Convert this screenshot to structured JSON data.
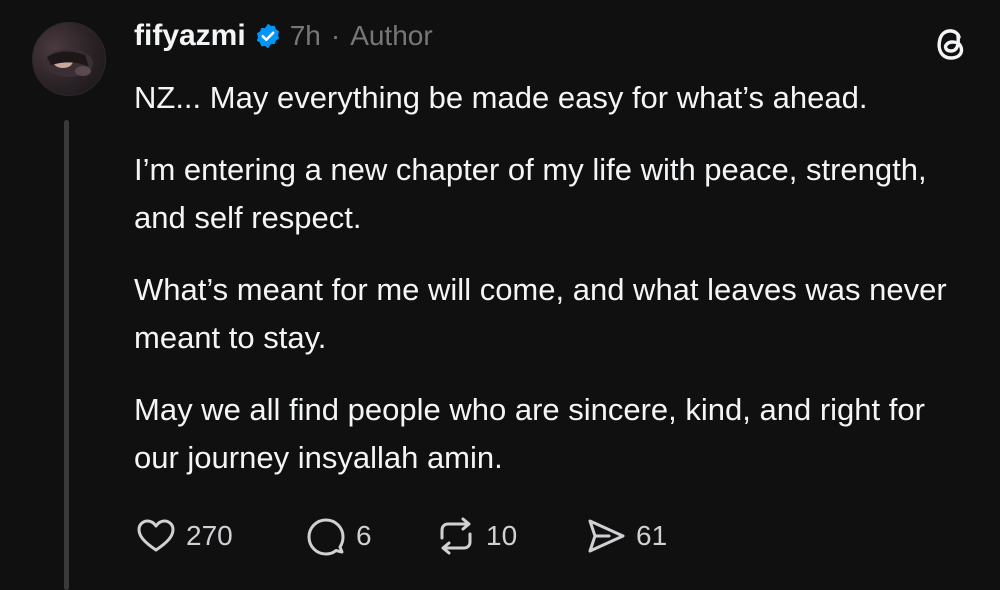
{
  "post": {
    "username": "fifyazmi",
    "time": "7h",
    "separator": "·",
    "role_badge": "Author",
    "paragraphs": [
      "NZ... May everything be made easy for what’s ahead.",
      "I’m entering a new chapter of my life with peace, strength, and self respect.",
      "What’s meant for me will come, and what leaves was never meant to stay.",
      "May we all find people who are sincere, kind, and right for our journey insyallah amin."
    ],
    "actions": {
      "likes": "270",
      "replies": "6",
      "reposts": "10",
      "shares": "61"
    }
  },
  "colors": {
    "background": "#101010",
    "text": "#f3f5f7",
    "muted": "#777777",
    "verified": "#0095f6"
  },
  "icons": [
    "verified-badge-icon",
    "threads-logo-icon",
    "heart-icon",
    "comment-icon",
    "repost-icon",
    "share-icon"
  ]
}
